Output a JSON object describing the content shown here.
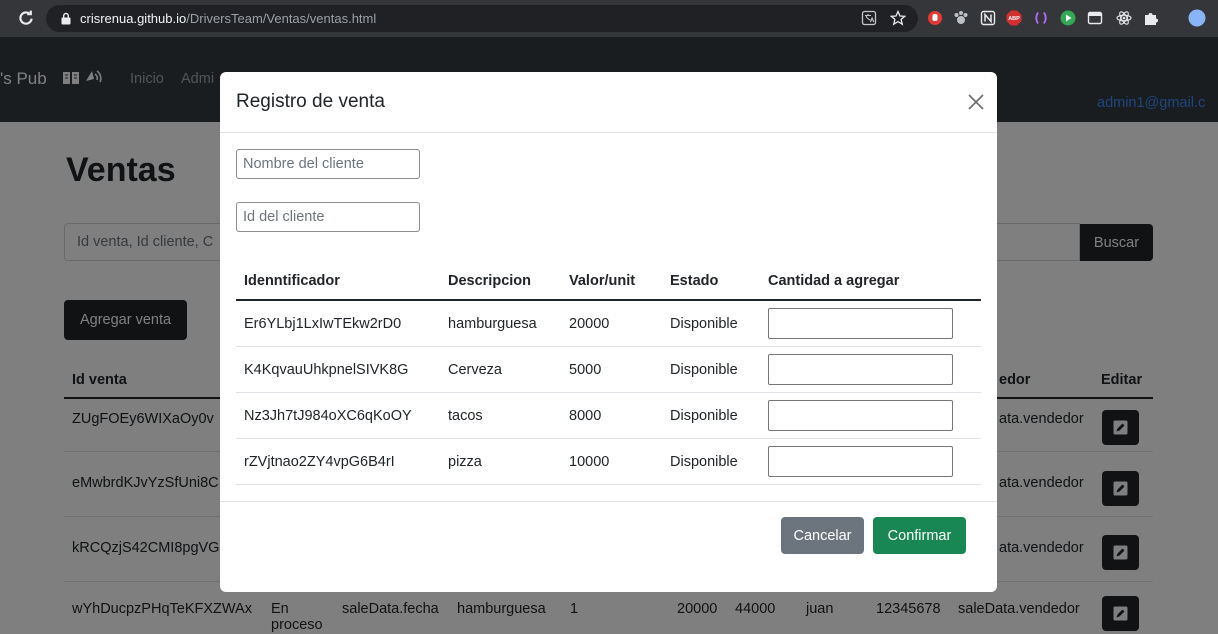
{
  "browser": {
    "url_host": "crisrenua.github.io",
    "url_path": "/DriversTeam/Ventas/ventas.html",
    "abp_logo_text": "ABP",
    "icons": [
      "reload-icon",
      "lock-icon",
      "translate-icon",
      "bookmark-star-icon",
      "hand-stop-extension-icon",
      "paw-extension-icon",
      "n-square-extension-icon",
      "adblock-plus-icon",
      "brackets-extension-icon",
      "play-extension-icon",
      "window-extension-icon",
      "atom-extension-icon",
      "puzzle-extensions-icon",
      "profile-avatar-icon"
    ]
  },
  "navbar": {
    "brand": "'s Pub",
    "links": [
      "Inicio",
      "Admi"
    ],
    "user_email": "admin1@gmail.c",
    "icons": [
      "book-icon",
      "speaker-icon"
    ]
  },
  "page": {
    "title": "Ventas",
    "search_placeholder": "Id venta, Id cliente, C",
    "search_button": "Buscar",
    "add_button": "Agregar venta",
    "table_headers": {
      "id": "Id venta",
      "seller": "edor",
      "edit": "Editar"
    },
    "rows": [
      {
        "id": "ZUgFOEy6WIXaOy0v",
        "seller": "ata.vendedor"
      },
      {
        "id": "eMwbrdKJvYzSfUni8C",
        "seller": "ata.vendedor"
      },
      {
        "id": "kRCQzjS42CMI8pgVG",
        "seller": "ata.vendedor"
      },
      {
        "id": "wYhDucpzPHqTeKFXZWAx",
        "status_line1": "En",
        "status_line2": "proceso",
        "date": "saleData.fecha",
        "product": "hamburguesa",
        "quantity": "1",
        "unit_price": "20000",
        "total": "44000",
        "client": "juan",
        "client_id": "12345678",
        "seller": "saleData.vendedor"
      }
    ],
    "edit_icon": "edit-icon"
  },
  "modal": {
    "title": "Registro de venta",
    "close_icon": "close-icon",
    "client_name_placeholder": "Nombre del cliente",
    "client_id_placeholder": "Id del cliente",
    "headers": [
      "Idenntificador",
      "Descripcion",
      "Valor/unit",
      "Estado",
      "Cantidad a agregar"
    ],
    "products": [
      {
        "id": "Er6YLbj1LxIwTEkw2rD0",
        "description": "hamburguesa",
        "unit_price": "20000",
        "status": "Disponible",
        "quantity": ""
      },
      {
        "id": "K4KqvauUhkpnelSIVK8G",
        "description": "Cerveza",
        "unit_price": "5000",
        "status": "Disponible",
        "quantity": ""
      },
      {
        "id": "Nz3Jh7tJ984oXC6qKoOY",
        "description": "tacos",
        "unit_price": "8000",
        "status": "Disponible",
        "quantity": ""
      },
      {
        "id": "rZVjtnao2ZY4vpG6B4rI",
        "description": "pizza",
        "unit_price": "10000",
        "status": "Disponible",
        "quantity": ""
      }
    ],
    "cancel_button": "Cancelar",
    "confirm_button": "Confirmar"
  },
  "colors": {
    "chrome_bg": "#35363a",
    "omnibox_bg": "#202124",
    "navbar_bg": "#343a40",
    "dark_button": "#212529",
    "link": "#3d8bfd",
    "secondary_button": "#6c757d",
    "success_button": "#198754",
    "overlay": "rgba(0,0,0,0.5)"
  }
}
